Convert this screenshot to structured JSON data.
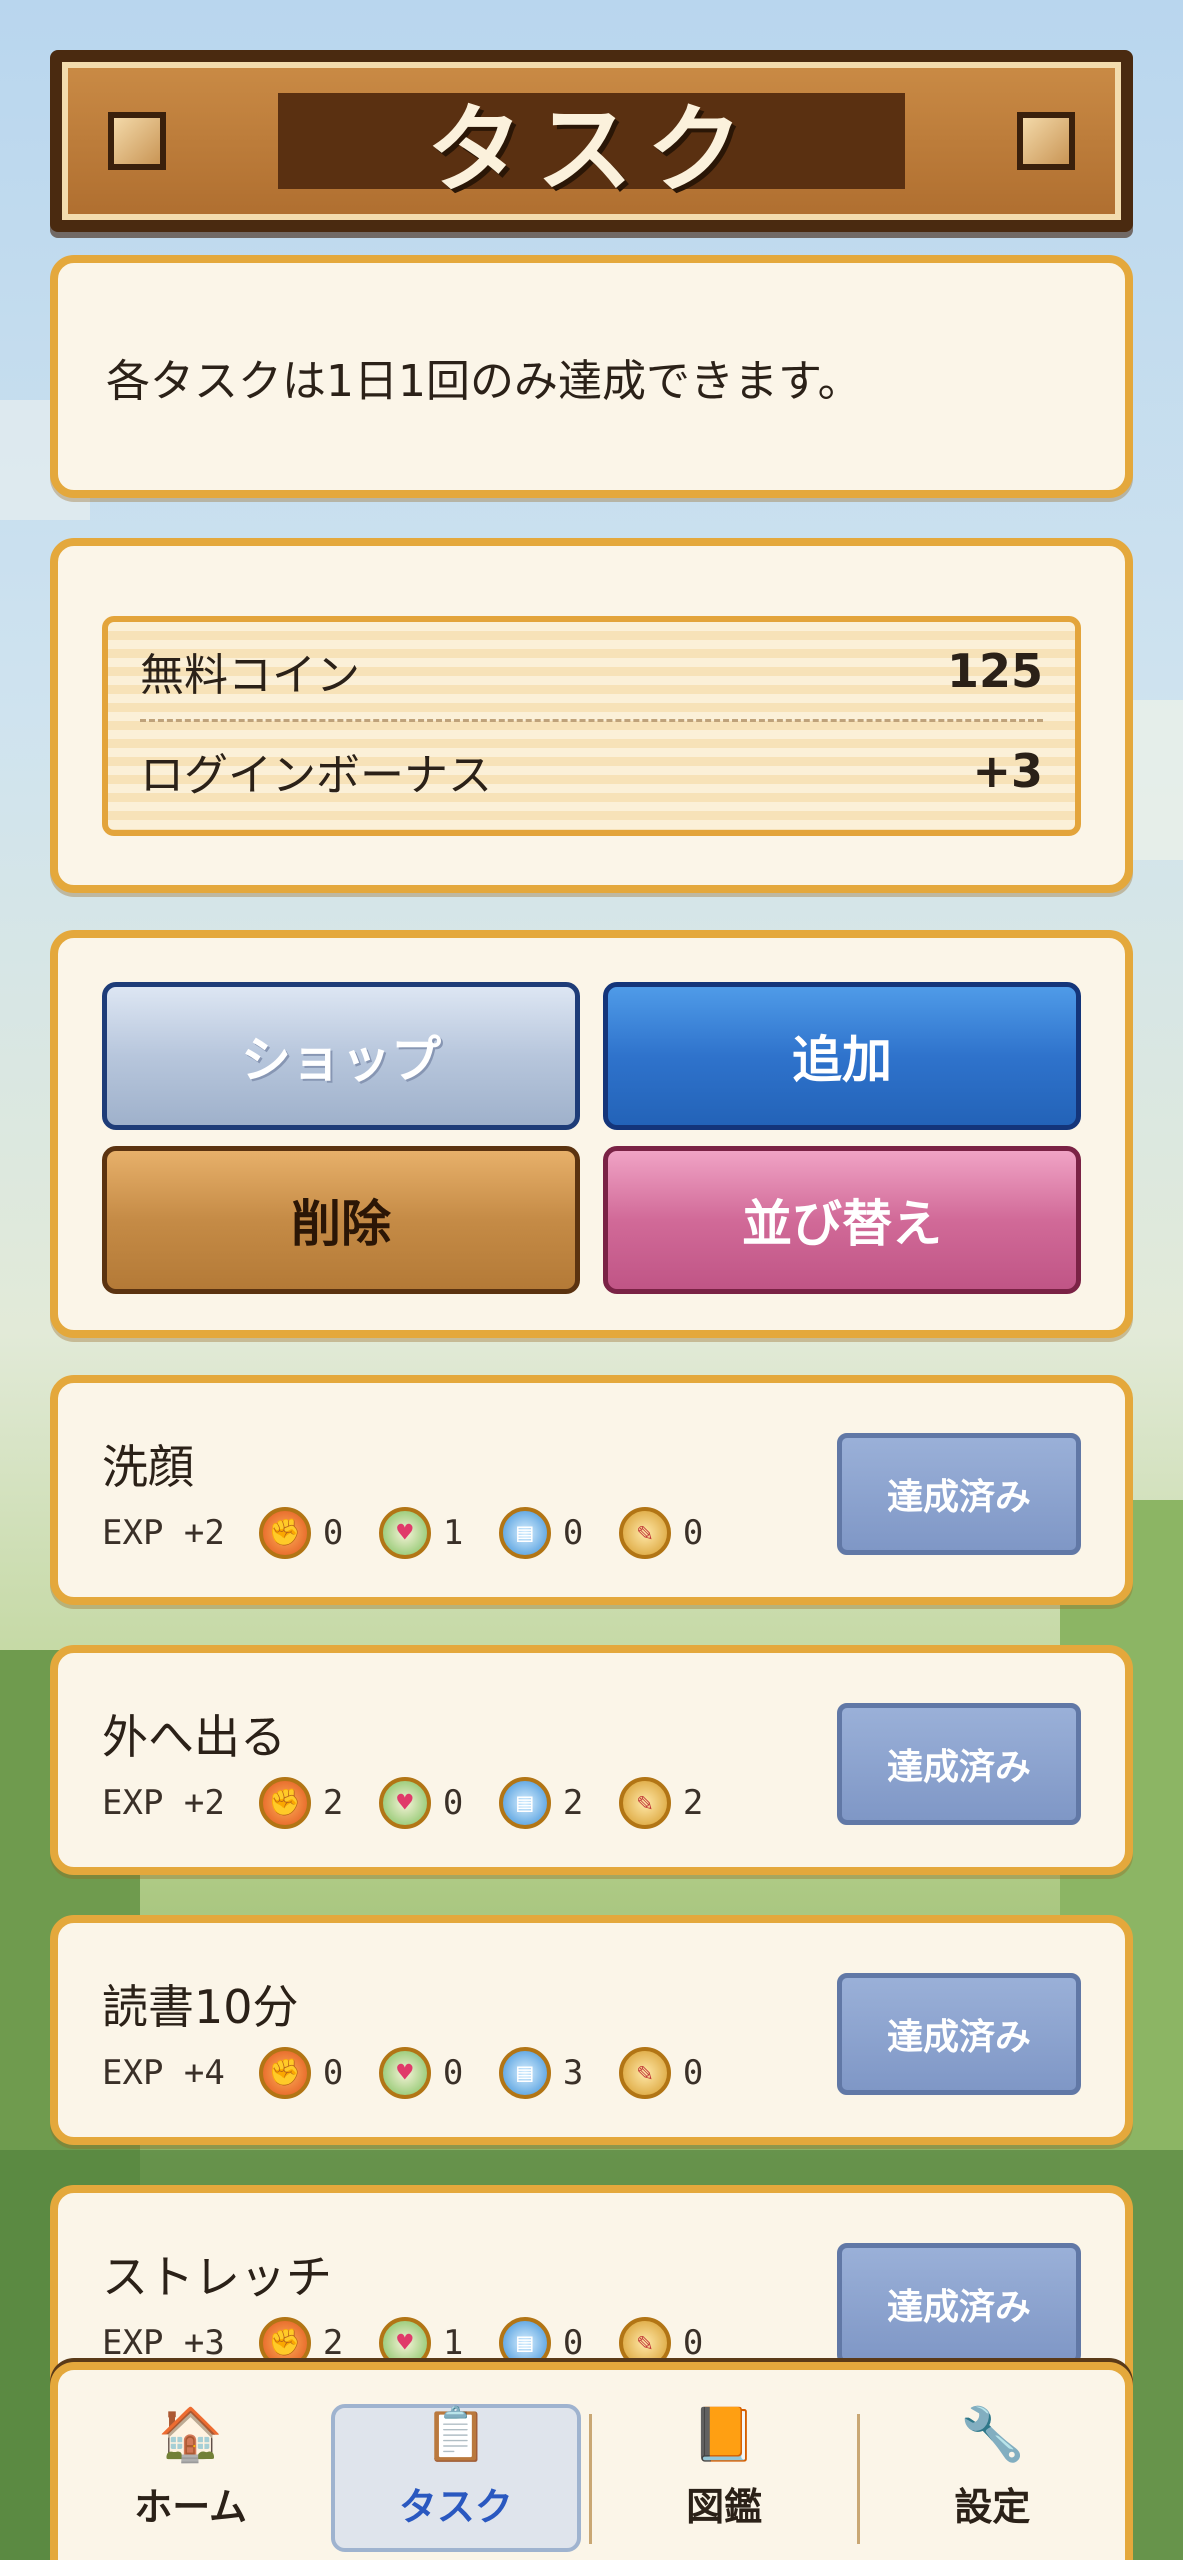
{
  "header": {
    "title": "タスク"
  },
  "notice": {
    "text": "各タスクは1日1回のみ達成できます。"
  },
  "coins": [
    {
      "label": "無料コイン",
      "value": "125"
    },
    {
      "label": "ログインボーナス",
      "value": "+3"
    }
  ],
  "actions": {
    "shop": "ショップ",
    "add": "追加",
    "delete": "削除",
    "sort": "並び替え"
  },
  "stat_icons": [
    "fire-fist-icon",
    "heart-icon",
    "book-icon",
    "palette-icon"
  ],
  "tasks": [
    {
      "title": "洗顔",
      "exp": "EXP +2",
      "stats": [
        "0",
        "1",
        "0",
        "0"
      ],
      "status": "達成済み"
    },
    {
      "title": "外へ出る",
      "exp": "EXP +2",
      "stats": [
        "2",
        "0",
        "2",
        "2"
      ],
      "status": "達成済み"
    },
    {
      "title": "読書10分",
      "exp": "EXP +4",
      "stats": [
        "0",
        "0",
        "3",
        "0"
      ],
      "status": "達成済み"
    },
    {
      "title": "ストレッチ",
      "exp": "EXP +3",
      "stats": [
        "2",
        "1",
        "0",
        "0"
      ],
      "status": "達成済み"
    }
  ],
  "nav": [
    {
      "label": "ホーム",
      "icon": "house-icon"
    },
    {
      "label": "タスク",
      "icon": "clipboard-icon",
      "active": true
    },
    {
      "label": "図鑑",
      "icon": "book-icon"
    },
    {
      "label": "設定",
      "icon": "wrench-gear-icon"
    }
  ],
  "colors": {
    "frame_orange": "#e4a83c",
    "card_bg": "#fbf5e8",
    "title_wood": "#5a3011",
    "shop": "#b7c6dc",
    "add": "#2f73cc",
    "delete": "#c58b46",
    "sort": "#d16a98",
    "done": "#7f97c6",
    "nav_active": "#2a58c0"
  }
}
